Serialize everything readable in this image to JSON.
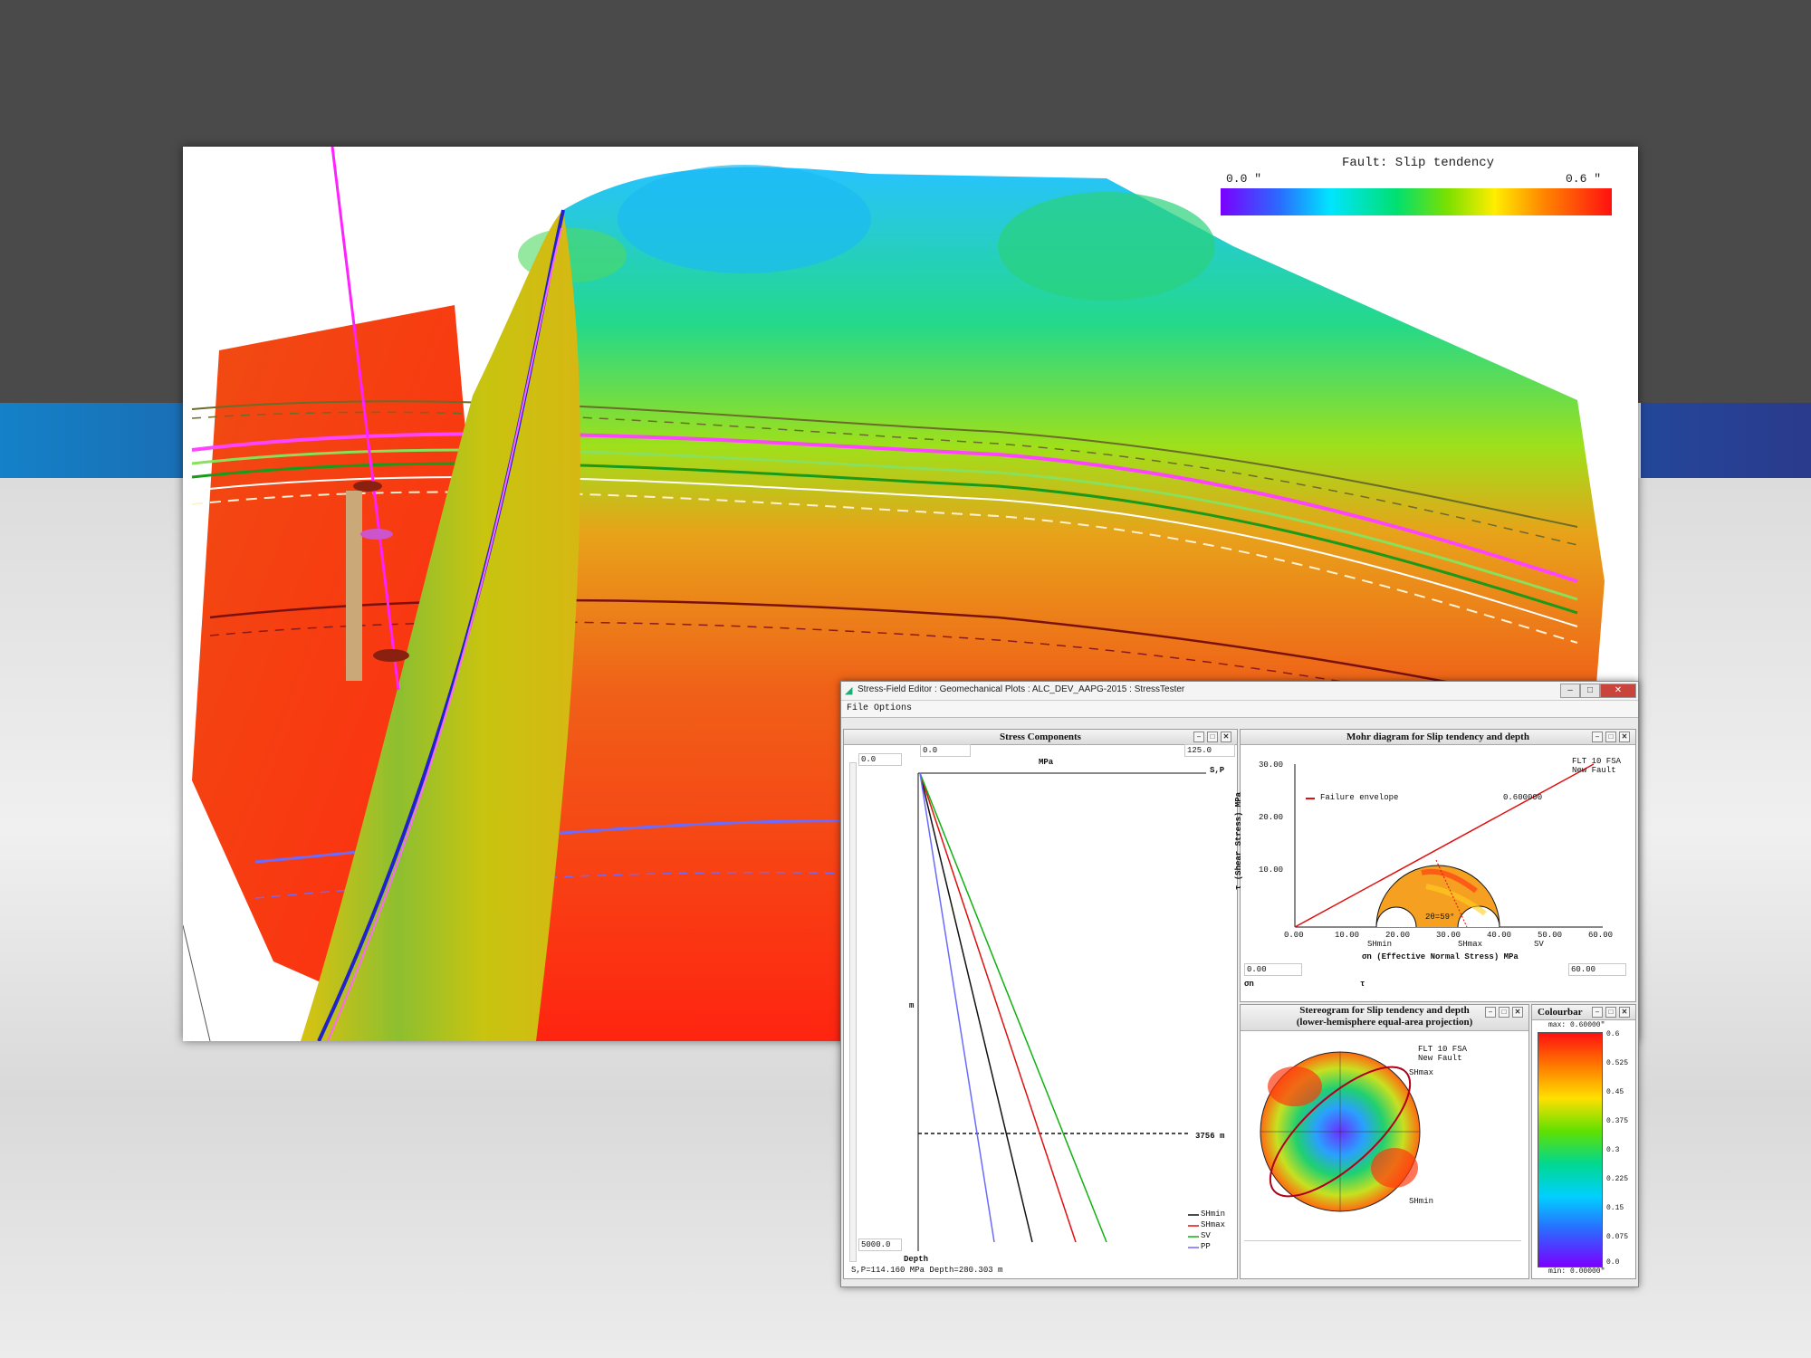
{
  "viewer3d": {
    "colorbar": {
      "title": "Fault: Slip tendency",
      "min_label": "0.0 \"",
      "max_label": "0.6 \"",
      "colors": [
        "#7a00ff",
        "#2a6bff",
        "#00e5ff",
        "#00e070",
        "#7be000",
        "#ffee00",
        "#ff8a00",
        "#ff1010"
      ]
    }
  },
  "app": {
    "title": "Stress-Field Editor : Geomechanical Plots : ALC_DEV_AAPG-2015 : StressTester",
    "menu": [
      "File",
      "Options"
    ],
    "window_buttons": {
      "minimize": "–",
      "maximize": "□",
      "close": "✕"
    },
    "stress_panel": {
      "title": "Stress Components",
      "depth_top": "0.0",
      "stress_min": "0.0",
      "stress_max": "125.0",
      "stress_unit": "MPa",
      "axis_label": "S,P",
      "depth_unit": "m",
      "depth_bottom": "5000.0",
      "depth_axis_label": "Depth",
      "depth_marker": "3756 m",
      "status": "S,P=114.160 MPa  Depth=280.303 m",
      "legend": [
        {
          "name": "SHmin",
          "color": "#111111"
        },
        {
          "name": "SHmax",
          "color": "#e01010"
        },
        {
          "name": "SV",
          "color": "#10b010"
        },
        {
          "name": "PP",
          "color": "#6a6aff"
        }
      ]
    },
    "mohr_panel": {
      "title": "Mohr diagram for Slip tendency and depth",
      "failure_label": "Failure envelope",
      "failure_value": "0.600000",
      "legend": [
        "FLT 10 FSA",
        "New Fault"
      ],
      "y_label": "τ (Shear Stress) MPa",
      "x_label": "σn (Effective Normal Stress) MPa",
      "angle_label": "2θ=59°",
      "y_ticks": [
        "30.00",
        "20.00",
        "10.00"
      ],
      "x_ticks": [
        "0.00",
        "10.00",
        "20.00",
        "30.00",
        "40.00",
        "50.00",
        "60.00"
      ],
      "principal_labels": [
        "SHmin",
        "SHmax",
        "SV"
      ],
      "sigma_min_field": "0.00",
      "sigma_max_field": "60.00",
      "sigma_symbol": "σn",
      "tau_symbol": "τ"
    },
    "stereo_panel": {
      "title_line1": "Stereogram for Slip tendency and depth",
      "title_line2": "(lower-hemisphere equal-area projection)",
      "legend": [
        "FLT 10 FSA",
        "New Fault"
      ],
      "labels": [
        "SHmax",
        "SHmin"
      ]
    },
    "colourbar_panel": {
      "title": "Colourbar",
      "max_label": "max: 0.60000\"",
      "min_label": "min: 0.00000\"",
      "ticks": [
        "0.6",
        "0.525",
        "0.45",
        "0.375",
        "0.3",
        "0.225",
        "0.15",
        "0.075",
        "0.0"
      ]
    },
    "panel_buttons": {
      "min": "–",
      "max": "□",
      "close": "✕"
    }
  }
}
